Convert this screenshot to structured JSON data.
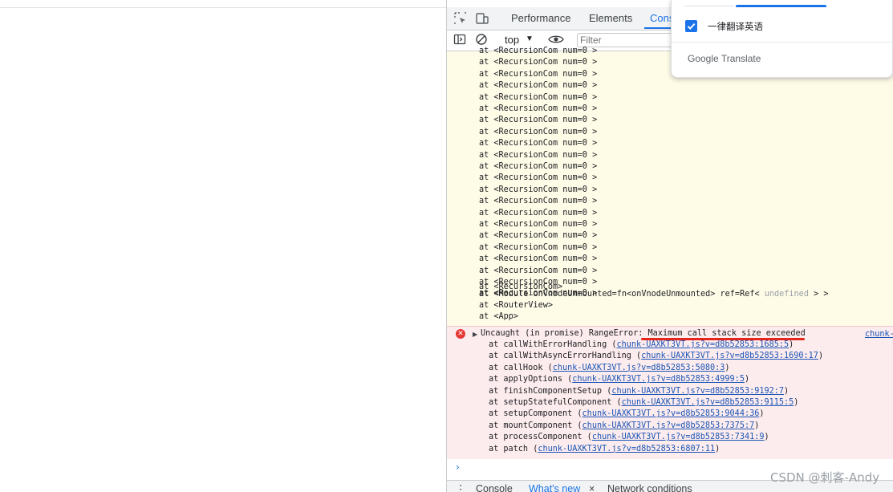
{
  "devtools": {
    "tabs": [
      "Performance",
      "Elements",
      "Cons"
    ],
    "toolbar": {
      "context": "top",
      "filter_placeholder": "Filter"
    }
  },
  "console": {
    "warning_lines": [
      "at <RecursionCom num=0 >",
      "at <RecursionCom num=0 >",
      "at <RecursionCom num=0 >",
      "at <RecursionCom num=0 >",
      "at <RecursionCom num=0 >",
      "at <RecursionCom num=0 >",
      "at <RecursionCom num=0 >",
      "at <RecursionCom num=0 >",
      "at <RecursionCom num=0 >",
      "at <RecursionCom num=0 >",
      "at <RecursionCom num=0 >",
      "at <RecursionCom num=0 >",
      "at <RecursionCom num=0 >",
      "at <RecursionCom num=0 >",
      "at <RecursionCom num=0 >",
      "at <RecursionCom num=0 >",
      "at <RecursionCom num=0 >",
      "at <RecursionCom num=0 >",
      "at <RecursionCom num=0 >",
      "at <RecursionCom num=0 >",
      "at <RecursionCom num=0 >",
      "at <RecursionCom num=0 >"
    ],
    "warning_tail": {
      "recursion": "at <RecursionCom>",
      "module_prefix": "at <Module onVnodeUnmounted=fn<onVnodeUnmounted> ref=Ref< ",
      "module_undefined": "undefined",
      "module_suffix": " > >",
      "router": "at <RouterView>",
      "app": "at <App>"
    },
    "error": {
      "prefix": "Uncaught (in promise) RangeError: ",
      "message": "Maximum call stack size exceeded",
      "source_link": "chunk-",
      "stack": [
        {
          "fn": "at callWithErrorHandling (",
          "link": "chunk-UAXKT3VT.js?v=d8b52853:1685:5",
          "end": ")"
        },
        {
          "fn": "at callWithAsyncErrorHandling (",
          "link": "chunk-UAXKT3VT.js?v=d8b52853:1690:17",
          "end": ")"
        },
        {
          "fn": "at callHook (",
          "link": "chunk-UAXKT3VT.js?v=d8b52853:5080:3",
          "end": ")"
        },
        {
          "fn": "at applyOptions (",
          "link": "chunk-UAXKT3VT.js?v=d8b52853:4999:5",
          "end": ")"
        },
        {
          "fn": "at finishComponentSetup (",
          "link": "chunk-UAXKT3VT.js?v=d8b52853:9192:7",
          "end": ")"
        },
        {
          "fn": "at setupStatefulComponent (",
          "link": "chunk-UAXKT3VT.js?v=d8b52853:9115:5",
          "end": ")"
        },
        {
          "fn": "at setupComponent (",
          "link": "chunk-UAXKT3VT.js?v=d8b52853:9044:36",
          "end": ")"
        },
        {
          "fn": "at mountComponent (",
          "link": "chunk-UAXKT3VT.js?v=d8b52853:7375:7",
          "end": ")"
        },
        {
          "fn": "at processComponent (",
          "link": "chunk-UAXKT3VT.js?v=d8b52853:7341:9",
          "end": ")"
        },
        {
          "fn": "at patch (",
          "link": "chunk-UAXKT3VT.js?v=d8b52853:6807:11",
          "end": ")"
        }
      ]
    },
    "prompt": "›"
  },
  "drawer": {
    "console": "Console",
    "whats_new": "What's new",
    "close": "×",
    "network": "Network conditions"
  },
  "translate_popup": {
    "checkbox_label": "一律翻译英语",
    "brand": "Google Translate",
    "checked": true
  },
  "watermark": "CSDN @刺客-Andy",
  "colors": {
    "accent": "#1a73e8",
    "error": "#e53935",
    "warning_bg": "#fefbe7",
    "error_bg": "#fdecee"
  }
}
